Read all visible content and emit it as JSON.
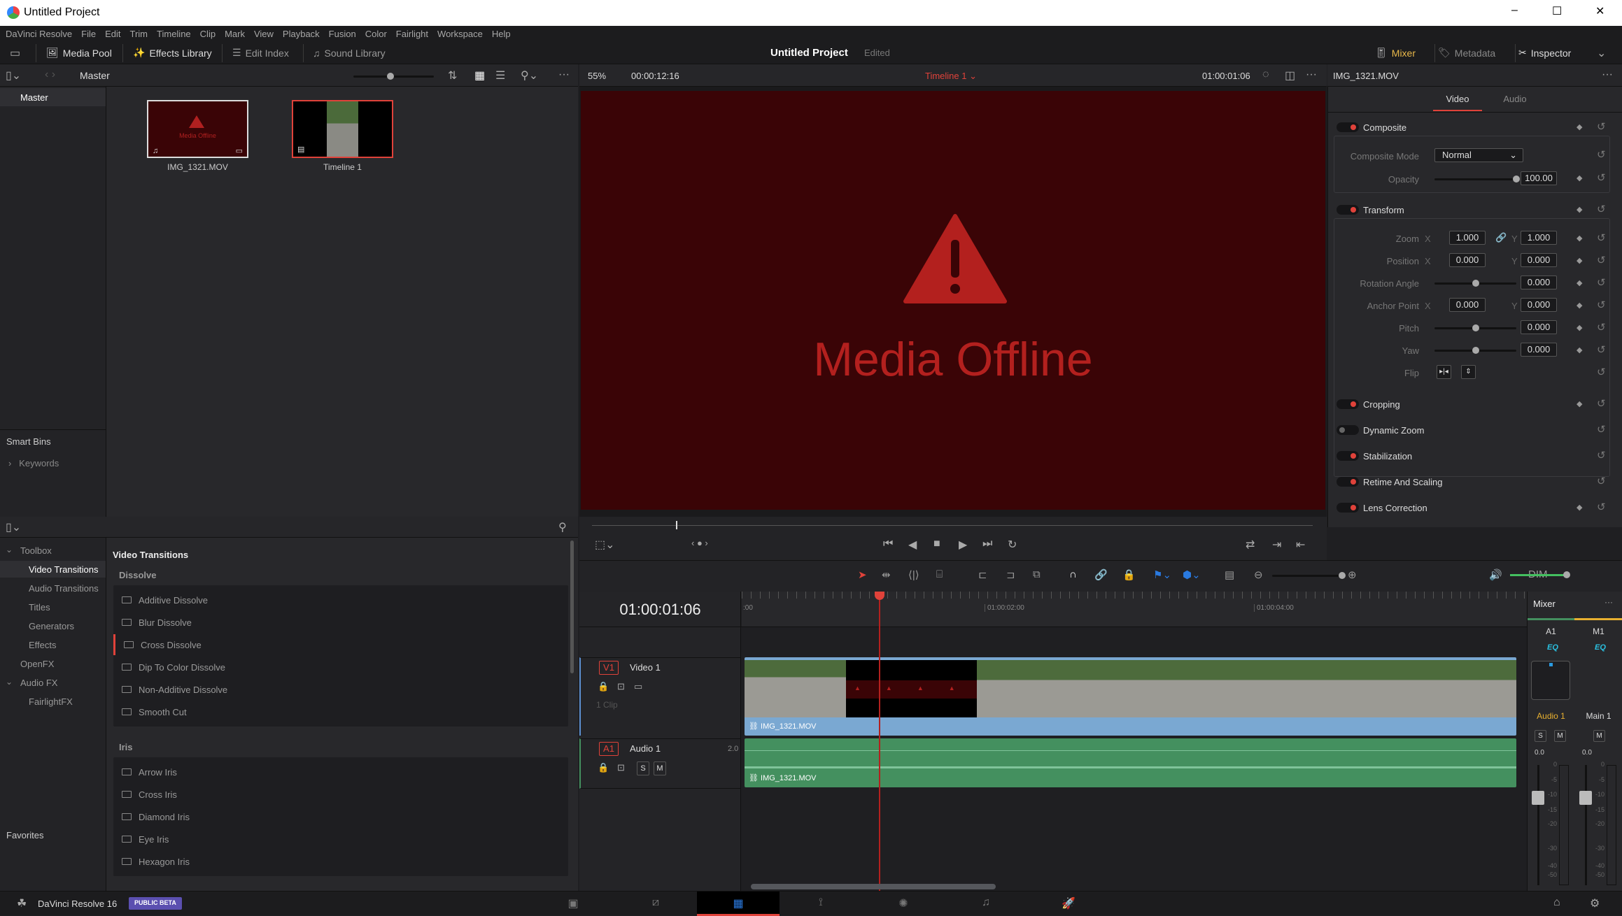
{
  "window": {
    "title": "Untitled Project",
    "minimize": "–",
    "maximize": "☐",
    "close": "✕"
  },
  "menu": [
    "DaVinci Resolve",
    "File",
    "Edit",
    "Trim",
    "Timeline",
    "Clip",
    "Mark",
    "View",
    "Playback",
    "Fusion",
    "Color",
    "Fairlight",
    "Workspace",
    "Help"
  ],
  "toolbar": {
    "media_pool": "Media Pool",
    "effects_library": "Effects Library",
    "edit_index": "Edit Index",
    "sound_library": "Sound Library",
    "project_title": "Untitled Project",
    "project_status": "Edited",
    "mixer": "Mixer",
    "metadata": "Metadata",
    "inspector": "Inspector"
  },
  "media_pool": {
    "bin": "Master",
    "bins": [
      "Master"
    ],
    "smart_bins": "Smart Bins",
    "keywords": "Keywords",
    "clips": [
      {
        "name": "IMG_1321.MOV",
        "thumb_text": "Media Offline"
      },
      {
        "name": "Timeline 1"
      }
    ]
  },
  "viewer": {
    "zoom": "55%",
    "duration": "00:00:12:16",
    "timeline_name": "Timeline 1",
    "timecode": "01:00:01:06",
    "offline_text": "Media Offline",
    "accent": "#e0423a",
    "bg": "#3a0406"
  },
  "effects": {
    "sidebar": [
      {
        "label": "Toolbox",
        "level": 0,
        "expanded": true
      },
      {
        "label": "Video Transitions",
        "level": 1,
        "selected": true
      },
      {
        "label": "Audio Transitions",
        "level": 1
      },
      {
        "label": "Titles",
        "level": 1
      },
      {
        "label": "Generators",
        "level": 1
      },
      {
        "label": "Effects",
        "level": 1
      },
      {
        "label": "OpenFX",
        "level": 0
      },
      {
        "label": "Audio FX",
        "level": 0,
        "expanded": true
      },
      {
        "label": "FairlightFX",
        "level": 1
      }
    ],
    "favorites": "Favorites",
    "title": "Video Transitions",
    "groups": [
      {
        "name": "Dissolve",
        "items": [
          "Additive Dissolve",
          "Blur Dissolve",
          "Cross Dissolve",
          "Dip To Color Dissolve",
          "Non-Additive Dissolve",
          "Smooth Cut"
        ]
      },
      {
        "name": "Iris",
        "items": [
          "Arrow Iris",
          "Cross Iris",
          "Diamond Iris",
          "Eye Iris",
          "Hexagon Iris"
        ]
      }
    ]
  },
  "inspector": {
    "clip": "IMG_1321.MOV",
    "tabs": [
      "Video",
      "Audio"
    ],
    "active_tab": "Video",
    "composite": {
      "title": "Composite",
      "mode_label": "Composite Mode",
      "mode": "Normal",
      "opacity_label": "Opacity",
      "opacity": "100.00"
    },
    "transform": {
      "title": "Transform",
      "rows": [
        {
          "label": "Zoom",
          "x": "1.000",
          "y": "1.000",
          "type": "xy",
          "link": true
        },
        {
          "label": "Position",
          "x": "0.000",
          "y": "0.000",
          "type": "xy"
        },
        {
          "label": "Rotation Angle",
          "value": "0.000",
          "type": "slider"
        },
        {
          "label": "Anchor Point",
          "x": "0.000",
          "y": "0.000",
          "type": "xy"
        },
        {
          "label": "Pitch",
          "value": "0.000",
          "type": "slider"
        },
        {
          "label": "Yaw",
          "value": "0.000",
          "type": "slider"
        },
        {
          "label": "Flip",
          "type": "flip"
        }
      ]
    },
    "sections": [
      {
        "title": "Cropping",
        "on": true
      },
      {
        "title": "Dynamic Zoom",
        "on": false
      },
      {
        "title": "Stabilization",
        "on": true
      },
      {
        "title": "Retime And Scaling",
        "on": true
      },
      {
        "title": "Lens Correction",
        "on": true
      }
    ]
  },
  "timeline": {
    "timecode": "01:00:01:06",
    "ruler": [
      ":00",
      "01:00:02:00",
      "01:00:04:00"
    ],
    "video_track": {
      "id": "V1",
      "name": "Video 1",
      "clips": "1 Clip",
      "clip_name": "IMG_1321.MOV"
    },
    "audio_track": {
      "id": "A1",
      "name": "Audio 1",
      "channels": "2.0",
      "clip_name": "IMG_1321.MOV",
      "s": "S",
      "m": "M"
    },
    "colors": {
      "video": "#7aa8d2",
      "audio": "#44905f",
      "playhead": "#e0423a"
    }
  },
  "mixer": {
    "title": "Mixer",
    "channels": [
      {
        "id": "A1",
        "name": "Audio 1",
        "eq": "EQ",
        "gain": "0.0",
        "buttons": [
          "S",
          "M"
        ]
      },
      {
        "id": "M1",
        "name": "Main 1",
        "eq": "EQ",
        "gain": "0.0",
        "buttons": [
          "M"
        ]
      }
    ],
    "scale": [
      "0",
      "-5",
      "-10",
      "-15",
      "-20",
      "-30",
      "-40",
      "-50"
    ]
  },
  "footer": {
    "app": "DaVinci Resolve 16",
    "badge": "PUBLIC BETA",
    "pages": [
      "media",
      "cut",
      "edit",
      "fusion",
      "color",
      "fairlight",
      "deliver"
    ],
    "active_page": "edit"
  }
}
